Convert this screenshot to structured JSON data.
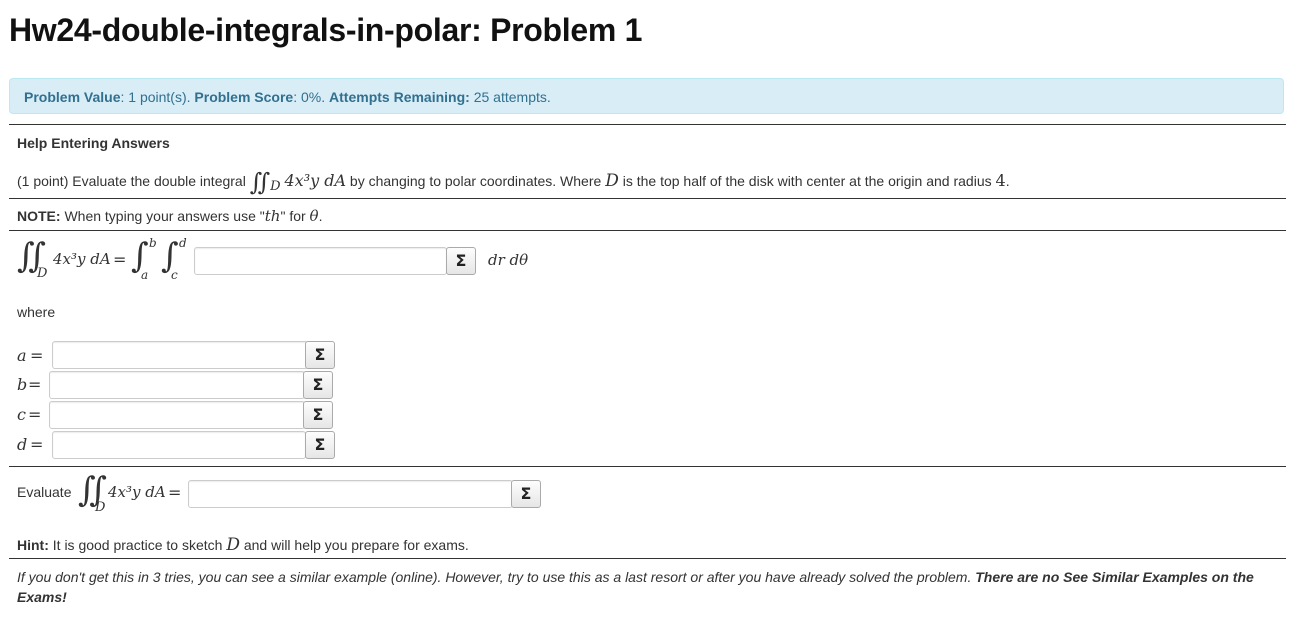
{
  "page": {
    "title": "Hw24-double-integrals-in-polar: Problem 1"
  },
  "info": {
    "value_label": "Problem Value",
    "value_text": ": 1 point(s).",
    "score_label": "Problem Score",
    "score_text": ": 0%.",
    "attempts_label": "Attempts Remaining:",
    "attempts_text": "25 attempts."
  },
  "help_link": "Help Entering Answers",
  "problem": {
    "intro": "(1 point) Evaluate the double integral",
    "integrand": "4x³y dA",
    "region": "D",
    "after": "by changing to polar coordinates. Where",
    "region_var": "D",
    "description": "is the top half of the disk with center at the origin and radius",
    "radius": "4",
    "period": "."
  },
  "note": {
    "label": "NOTE:",
    "text": "When typing your answers use \"",
    "code": "th",
    "text2": "\" for",
    "theta": "θ",
    "end": "."
  },
  "integral_row": {
    "lhs": "4x³y dA",
    "region": "D",
    "eq": "=",
    "upper_outer": "b",
    "lower_outer": "a",
    "upper_inner": "d",
    "lower_inner": "c",
    "suffix": "dr dθ",
    "input_value": "",
    "sigma": "Σ"
  },
  "where_label": "where",
  "bounds": [
    {
      "var": "a",
      "eq": "=",
      "value": "",
      "sigma": "Σ"
    },
    {
      "var": "b",
      "eq": "=",
      "value": "",
      "sigma": "Σ"
    },
    {
      "var": "c",
      "eq": "=",
      "value": "",
      "sigma": "Σ"
    },
    {
      "var": "d",
      "eq": "=",
      "value": "",
      "sigma": "Σ"
    }
  ],
  "evaluate": {
    "label": "Evaluate",
    "integrand": "4x³y dA",
    "region": "D",
    "eq": "=",
    "value": "",
    "sigma": "Σ"
  },
  "hint": {
    "label": "Hint:",
    "text": "It is good practice to sketch",
    "var": "D",
    "text2": "and will help you prepare for exams."
  },
  "footer": {
    "text": "If you don't get this in 3 tries, you can see a similar example (online). However, try to use this as a last resort or after you have already solved the problem.",
    "bold": "There are no See Similar Examples on the Exams!"
  }
}
